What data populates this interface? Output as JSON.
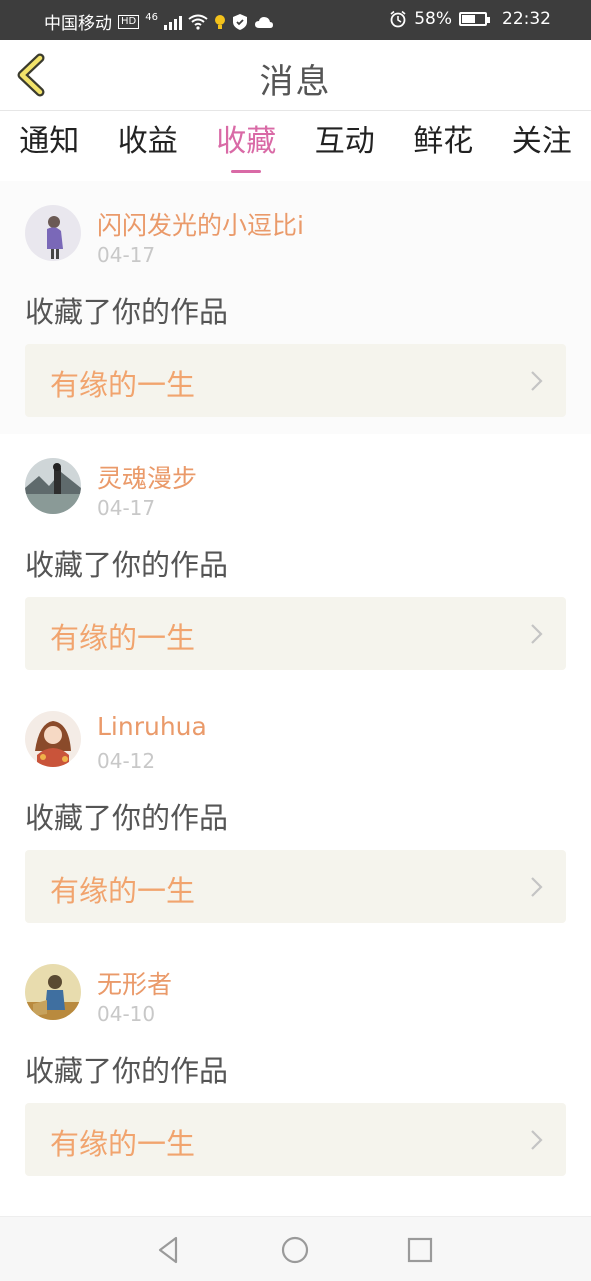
{
  "status_bar": {
    "carrier": "中国移动",
    "hd": "HD",
    "network": "46",
    "battery": "58%",
    "battery_level": 0.58,
    "time": "22:32"
  },
  "header": {
    "title": "消息",
    "back_icon": "chevron-left-icon"
  },
  "tabs": [
    {
      "label": "通知",
      "active": false
    },
    {
      "label": "收益",
      "active": false
    },
    {
      "label": "收藏",
      "active": true
    },
    {
      "label": "互动",
      "active": false
    },
    {
      "label": "鲜花",
      "active": false
    },
    {
      "label": "关注",
      "active": false
    }
  ],
  "notifications": [
    {
      "user": "闪闪发光的小逗比i",
      "date": "04-17",
      "action": "收藏了你的作品",
      "work": "有缘的一生"
    },
    {
      "user": "灵魂漫步",
      "date": "04-17",
      "action": "收藏了你的作品",
      "work": "有缘的一生"
    },
    {
      "user": "Linruhua",
      "date": "04-12",
      "action": "收藏了你的作品",
      "work": "有缘的一生"
    },
    {
      "user": "无形者",
      "date": "04-10",
      "action": "收藏了你的作品",
      "work": "有缘的一生"
    }
  ],
  "colors": {
    "accent_tab": "#d96aa6",
    "username": "#ea9a6a",
    "work_title": "#f1a46e",
    "work_bg": "#f5f4ed"
  }
}
